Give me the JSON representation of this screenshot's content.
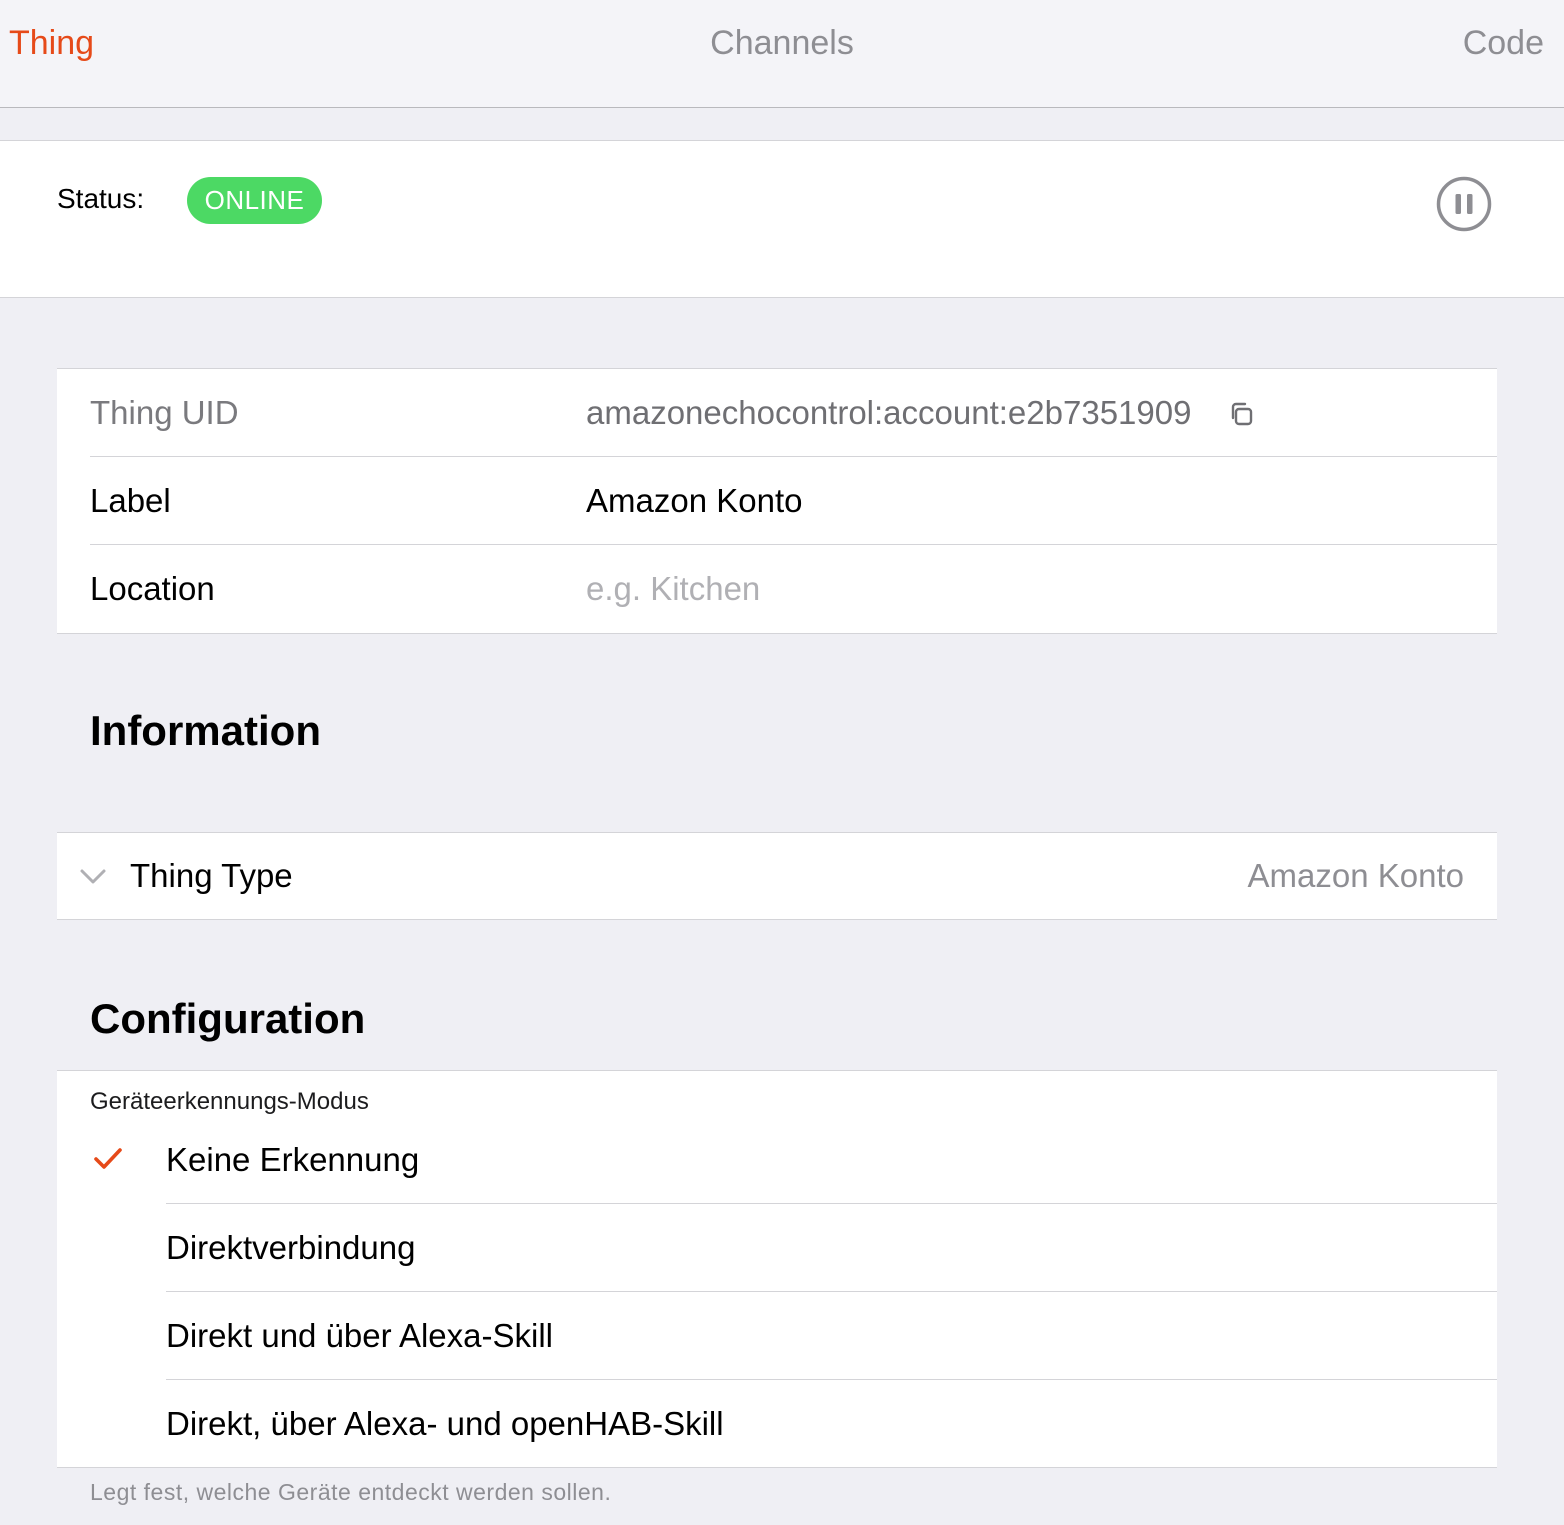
{
  "tabs": {
    "thing": "Thing",
    "channels": "Channels",
    "code": "Code"
  },
  "status": {
    "label": "Status:",
    "value": "ONLINE",
    "badge_color": "#4cd964"
  },
  "details": {
    "uid_label": "Thing UID",
    "uid_value": "amazonechocontrol:account:e2b7351909",
    "label_label": "Label",
    "label_value": "Amazon Konto",
    "location_label": "Location",
    "location_placeholder": "e.g. Kitchen"
  },
  "information": {
    "title": "Information",
    "thing_type_label": "Thing Type",
    "thing_type_value": "Amazon Konto"
  },
  "configuration": {
    "title": "Configuration",
    "param_label": "Geräteerkennungs-Modus",
    "options": [
      {
        "label": "Keine Erkennung",
        "selected": true
      },
      {
        "label": "Direktverbindung",
        "selected": false
      },
      {
        "label": "Direkt und über Alexa-Skill",
        "selected": false
      },
      {
        "label": "Direkt, über Alexa- und openHAB-Skill",
        "selected": false
      }
    ],
    "description": "Legt fest, welche Geräte entdeckt werden sollen."
  },
  "icons": {
    "pause": "pause-circle-icon",
    "copy": "copy-icon",
    "chevron": "chevron-down-icon",
    "check": "checkmark-icon"
  },
  "colors": {
    "accent": "#e64a19",
    "online": "#4cd964"
  }
}
